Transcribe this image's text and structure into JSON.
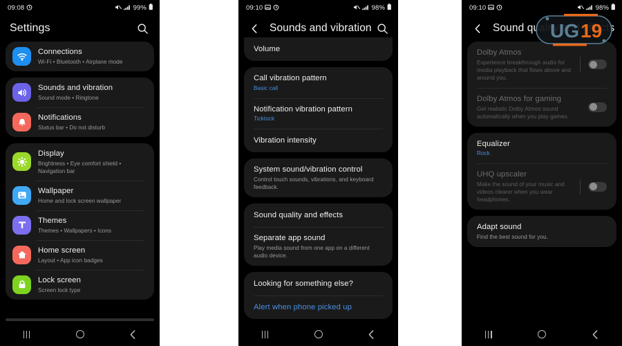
{
  "panels": [
    {
      "id": "settings-home",
      "statusbar": {
        "time": "09:08",
        "icons_left": [
          "alarm-icon"
        ],
        "icons_right": [
          "mute-icon",
          "signal-icon"
        ],
        "battery": "99%"
      },
      "appbar": {
        "title": "Settings",
        "search_label": "Search"
      },
      "groups": [
        {
          "items": [
            {
              "title": "Connections",
              "sub": "Wi-Fi  •  Bluetooth  •  Airplane mode",
              "icon": "wifi-icon",
              "color": "#1e8ff0"
            }
          ]
        },
        {
          "items": [
            {
              "title": "Sounds and vibration",
              "sub": "Sound mode  •  Ringtone",
              "icon": "volume-icon",
              "color": "#6c63e8"
            },
            {
              "title": "Notifications",
              "sub": "Status bar  •  Do not disturb",
              "icon": "bell-icon",
              "color": "#f4695c"
            }
          ]
        },
        {
          "items": [
            {
              "title": "Display",
              "sub": "Brightness  •  Eye comfort shield  •  Navigation bar",
              "icon": "brightness-icon",
              "color": "#9ad82a"
            },
            {
              "title": "Wallpaper",
              "sub": "Home and lock screen wallpaper",
              "icon": "image-icon",
              "color": "#3fa9f5"
            },
            {
              "title": "Themes",
              "sub": "Themes  •  Wallpapers  •  Icons",
              "icon": "themes-icon",
              "color": "#7b6ff0"
            },
            {
              "title": "Home screen",
              "sub": "Layout  •  App icon badges",
              "icon": "home-icon",
              "color": "#f4695c"
            },
            {
              "title": "Lock screen",
              "sub": "Screen lock type",
              "icon": "lock-icon",
              "color": "#7ed321"
            }
          ]
        }
      ]
    },
    {
      "id": "sounds-and-vibration",
      "statusbar": {
        "time": "09:10",
        "icons_left": [
          "image-icon",
          "alarm-icon"
        ],
        "icons_right": [
          "mute-icon",
          "signal-icon"
        ],
        "battery": "98%"
      },
      "appbar": {
        "title": "Sounds and vibration",
        "back_label": "Back",
        "search_label": "Search"
      },
      "groups": [
        {
          "partial_top": true,
          "items": [
            {
              "title": "Volume",
              "sub": ""
            }
          ]
        },
        {
          "items": [
            {
              "title": "Call vibration pattern",
              "sub": "Basic call",
              "sub_accent": true
            },
            {
              "title": "Notification vibration pattern",
              "sub": "Ticktock",
              "sub_accent": true
            },
            {
              "title": "Vibration intensity",
              "sub": ""
            }
          ]
        },
        {
          "items": [
            {
              "title": "System sound/vibration control",
              "sub": "Control touch sounds, vibrations, and keyboard feedback."
            }
          ]
        },
        {
          "items": [
            {
              "title": "Sound quality and effects",
              "sub": ""
            },
            {
              "title": "Separate app sound",
              "sub": "Play media sound from one app on a different audio device."
            }
          ]
        },
        {
          "items": [
            {
              "title": "Looking for something else?",
              "sub": ""
            },
            {
              "title": "Alert when phone picked up",
              "sub": "",
              "title_accent": true
            }
          ]
        }
      ]
    },
    {
      "id": "sound-quality-and-effects",
      "statusbar": {
        "time": "09:10",
        "icons_left": [
          "image-icon",
          "alarm-icon"
        ],
        "icons_right": [
          "mute-icon",
          "signal-icon"
        ],
        "battery": "98%"
      },
      "appbar": {
        "title": "Sound quality and effects",
        "back_label": "Back"
      },
      "groups": [
        {
          "items": [
            {
              "title": "Dolby Atmos",
              "sub": "Experience breakthrough audio for media playback that flows above and around you.",
              "dim": true,
              "toggle": "off",
              "toggle_divider": true
            },
            {
              "title": "Dolby Atmos for gaming",
              "sub": "Get realistic Dolby Atmos sound automatically when you play games.",
              "dim": true,
              "toggle": "off"
            }
          ]
        },
        {
          "items": [
            {
              "title": "Equalizer",
              "sub": "Rock",
              "sub_accent": true
            },
            {
              "title": "UHQ upscaler",
              "sub": "Make the sound of your music and videos clearer when you wear headphones.",
              "dim": true,
              "toggle": "off",
              "toggle_divider": true
            }
          ]
        },
        {
          "items": [
            {
              "title": "Adapt sound",
              "sub": "Find the best sound for you."
            }
          ]
        }
      ]
    }
  ],
  "navbar": {
    "recents_label": "Recents",
    "home_label": "Home",
    "back_label": "Back"
  },
  "watermark": {
    "text_primary": "UG",
    "text_secondary": "19",
    "color_primary": "#5b7f96",
    "color_secondary": "#e8691a"
  },
  "colors": {
    "background": "#000000",
    "card": "#1a1a1a",
    "accent_link": "#4a90e2",
    "text_primary": "#f0f0f0",
    "text_secondary": "#9a9a9a"
  }
}
